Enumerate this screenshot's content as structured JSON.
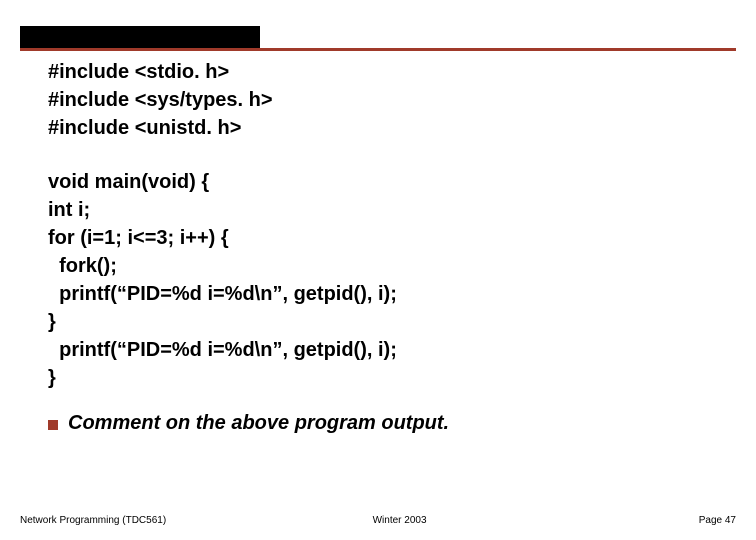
{
  "code": {
    "l1": "#include <stdio. h>",
    "l2": "#include <sys/types. h>",
    "l3": "#include <unistd. h>",
    "l4": "void main(void) {",
    "l5": "int i;",
    "l6": "for (i=1; i<=3; i++) {",
    "l7": "  fork();",
    "l8": "  printf(“PID=%d i=%d\\n”, getpid(), i);",
    "l9": "}",
    "l10": "  printf(“PID=%d i=%d\\n”, getpid(), i);",
    "l11": "}"
  },
  "bullet": {
    "text": "Comment on the above program output."
  },
  "footer": {
    "left": "Network Programming (TDC561)",
    "center": "Winter  2003",
    "right": "Page 47"
  }
}
